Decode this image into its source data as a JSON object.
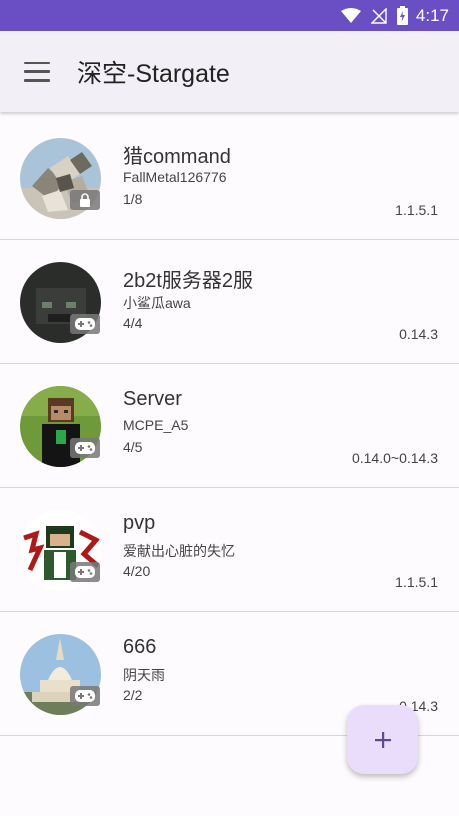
{
  "status_bar": {
    "time": "4:17",
    "icons": [
      "wifi-icon",
      "no-signal-icon",
      "battery-charging-icon"
    ],
    "background_color": "#6a4fc4"
  },
  "app_bar": {
    "menu_icon": "hamburger-menu-icon",
    "title": "深空-Stargate"
  },
  "servers": [
    {
      "name": "猎command",
      "owner": "FallMetal126776",
      "players": "1/8",
      "version": "1.1.5.1",
      "badge_icon": "lock-icon"
    },
    {
      "name": "2b2t服务器2服",
      "owner": "小鲨瓜awa",
      "players": "4/4",
      "version": "0.14.3",
      "badge_icon": "gamepad-icon"
    },
    {
      "name": "Server",
      "owner": "MCPE_A5",
      "players": "4/5",
      "version": "0.14.0~0.14.3",
      "badge_icon": "gamepad-icon"
    },
    {
      "name": "pvp",
      "owner": "爱献出心脏的失忆",
      "players": "4/20",
      "version": "1.1.5.1",
      "badge_icon": "gamepad-icon"
    },
    {
      "name": "666",
      "owner": "阴天雨",
      "players": "2/2",
      "version": "0.14.3",
      "badge_icon": "gamepad-icon"
    }
  ],
  "fab": {
    "icon": "plus-icon",
    "color": "#e9ddfb"
  }
}
